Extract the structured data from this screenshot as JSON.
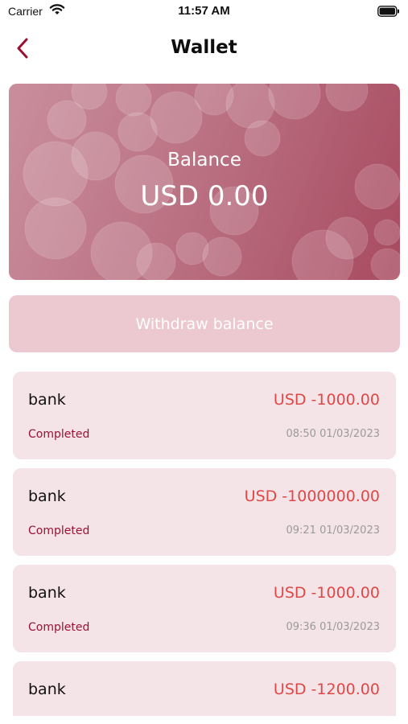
{
  "status_bar": {
    "carrier": "Carrier",
    "time": "11:57 AM",
    "icons": [
      "wifi-icon",
      "battery-icon"
    ]
  },
  "nav": {
    "title": "Wallet",
    "back_icon": "chevron-left-icon"
  },
  "balance": {
    "label": "Balance",
    "value": "USD 0.00"
  },
  "withdraw": {
    "label": "Withdraw balance"
  },
  "transactions": [
    {
      "method": "bank",
      "amount": "USD -1000.00",
      "status": "Completed",
      "date": "08:50 01/03/2023"
    },
    {
      "method": "bank",
      "amount": "USD -1000000.00",
      "status": "Completed",
      "date": "09:21 01/03/2023"
    },
    {
      "method": "bank",
      "amount": "USD -1000.00",
      "status": "Completed",
      "date": "09:36 01/03/2023"
    },
    {
      "method": "bank",
      "amount": "USD -1200.00",
      "status": "",
      "date": ""
    }
  ],
  "colors": {
    "accent": "#9b1132",
    "amount": "#e04848",
    "card_bg": "#f5e4e7",
    "withdraw_bg": "#ecc9d0"
  }
}
